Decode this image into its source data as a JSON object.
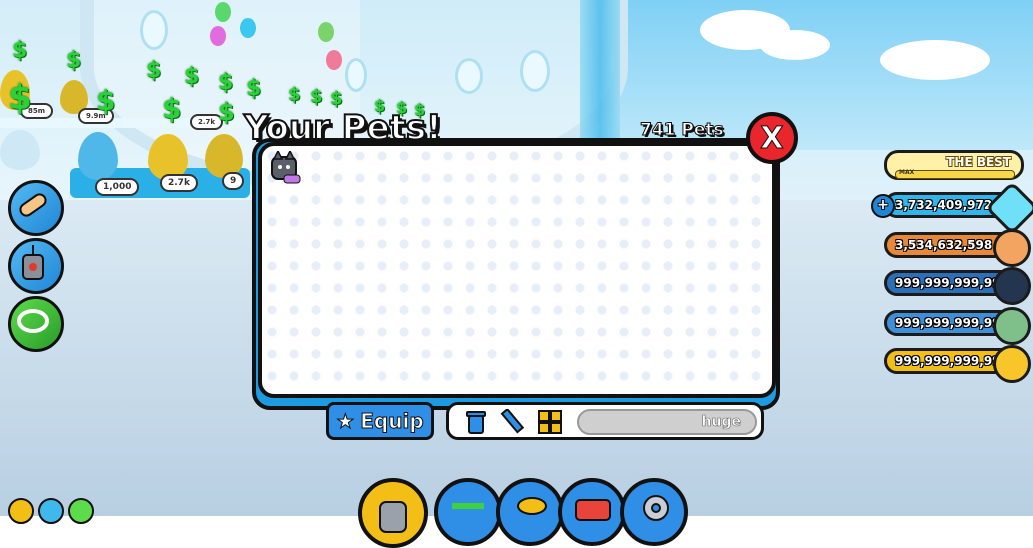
{
  "pets_window": {
    "title": "Your Pets!",
    "count": "741 Pets",
    "close_label": "X",
    "equip_label": "Equip",
    "search_value": "huge"
  },
  "rank": {
    "label": "THE BEST",
    "bar_label": "MAX",
    "progress": 1.0
  },
  "currencies": [
    {
      "value": "3,732,409,972",
      "icon": "diamond-icon",
      "color": "#2fb6ec",
      "plus": "+"
    },
    {
      "value": "3,534,632,598",
      "icon": "paw-coin-icon",
      "color": "#e8893a"
    },
    {
      "value": "999,999,999,999",
      "icon": "tech-coin-icon",
      "color": "#2a6fb8"
    },
    {
      "value": "999,999,999,999",
      "icon": "fantasy-coin-icon",
      "color": "#3f8fd8"
    },
    {
      "value": "999,999,999,999",
      "icon": "gold-coin-icon",
      "color": "#f3bf16"
    }
  ],
  "shop": {
    "prices": [
      "1,000",
      "2.7k",
      "9",
      "85m",
      "9.9m",
      "2.7k"
    ]
  }
}
